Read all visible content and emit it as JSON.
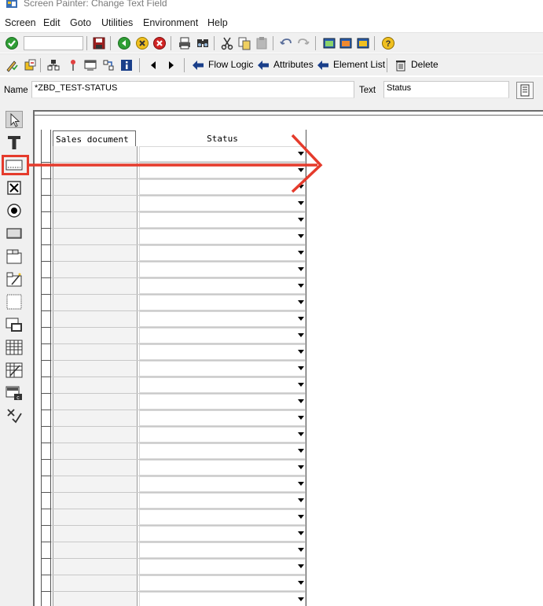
{
  "window": {
    "title": "Screen Painter: Change Text Field"
  },
  "menu": [
    "Screen",
    "Edit",
    "Goto",
    "Utilities",
    "Environment",
    "Help"
  ],
  "toolbar2": {
    "flow_logic": "Flow Logic",
    "attributes": "Attributes",
    "element_list": "Element List",
    "delete": "Delete"
  },
  "namerow": {
    "name_label": "Name",
    "name_value": "*ZBD_TEST-STATUS",
    "text_label": "Text",
    "text_value": "Status"
  },
  "palette": [
    {
      "name": "pointer-icon"
    },
    {
      "name": "text-field-icon"
    },
    {
      "name": "input-output-field-icon",
      "active": true
    },
    {
      "name": "checkbox-icon"
    },
    {
      "name": "radio-button-icon"
    },
    {
      "name": "pushbutton-icon"
    },
    {
      "name": "tabstrip-icon"
    },
    {
      "name": "tabstrip-wizard-icon"
    },
    {
      "name": "box-icon"
    },
    {
      "name": "subscreen-icon"
    },
    {
      "name": "table-control-icon"
    },
    {
      "name": "table-control-wizard-icon"
    },
    {
      "name": "custom-control-icon"
    },
    {
      "name": "status-icon-element"
    }
  ],
  "table": {
    "headers": [
      "Sales document",
      "Status"
    ],
    "row_count": 28
  },
  "colors": {
    "annotation": "#e53b2c",
    "window_bg": "#f0f0f0"
  }
}
